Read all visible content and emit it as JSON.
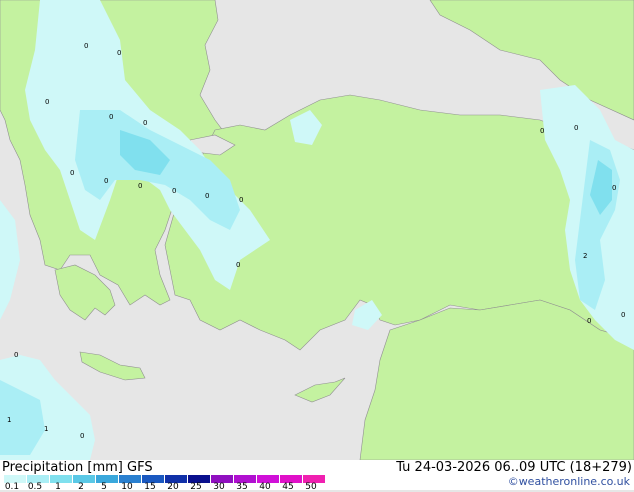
{
  "footer": {
    "title": "Precipitation [mm]  GFS",
    "valid_time": "Tu 24-03-2026 06..09 UTC (18+279)",
    "credit": "©weatheronline.co.uk"
  },
  "legend": {
    "levels": [
      "0.1",
      "0.5",
      "1",
      "2",
      "5",
      "10",
      "15",
      "20",
      "25",
      "30",
      "35",
      "40",
      "45",
      "50"
    ],
    "colors": [
      "#cff8f8",
      "#aaeef5",
      "#80e0ee",
      "#5ac8e6",
      "#3aa8dc",
      "#2a80d0",
      "#1a58c0",
      "#1030a8",
      "#0a108e",
      "#9010c0",
      "#b010d0",
      "#d010d8",
      "#e010c8",
      "#f020b0"
    ]
  },
  "map_colors": {
    "sea": "#e6e6e6",
    "land_dry": "#c4f2a0",
    "precip_light": "#cff8f8",
    "precip_medium": "#aaeef5",
    "precip_heavy": "#80e0ee",
    "border": "#a0a0a0"
  },
  "map_labels": [
    "0",
    "0",
    "0",
    "0",
    "0",
    "0",
    "0",
    "0",
    "0",
    "0",
    "0",
    "0",
    "0",
    "0",
    "0",
    "2",
    "0",
    "0",
    "0",
    "1",
    "1",
    "0",
    "0"
  ]
}
